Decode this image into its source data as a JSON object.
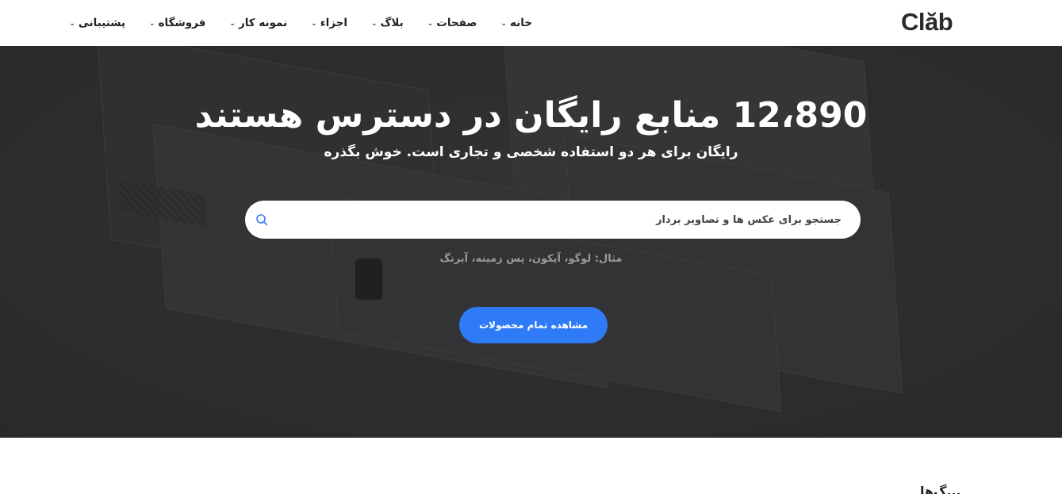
{
  "header": {
    "logo": "Clăb",
    "nav": [
      {
        "label": "خانه"
      },
      {
        "label": "صفحات"
      },
      {
        "label": "بلاگ"
      },
      {
        "label": "اجزاء"
      },
      {
        "label": "نمونه کار"
      },
      {
        "label": "فروشگاه"
      },
      {
        "label": "پشتیبانی"
      }
    ]
  },
  "hero": {
    "title": "12،890 منابع رایگان در دسترس هستند",
    "subtitle": "رایگان برای هر دو استفاده شخصی و تجاری است. خوش بگذره",
    "search_placeholder": "جستجو برای عکس ها و تصاویر بردار",
    "search_icon": "search-icon",
    "example": "مثال: لوگو، آیکون، پس زمینه، آبرنگ",
    "cta_label": "مشاهده تمام محصولات",
    "cta_color": "#2f7af6"
  },
  "section_peek": "...گ‌ها"
}
